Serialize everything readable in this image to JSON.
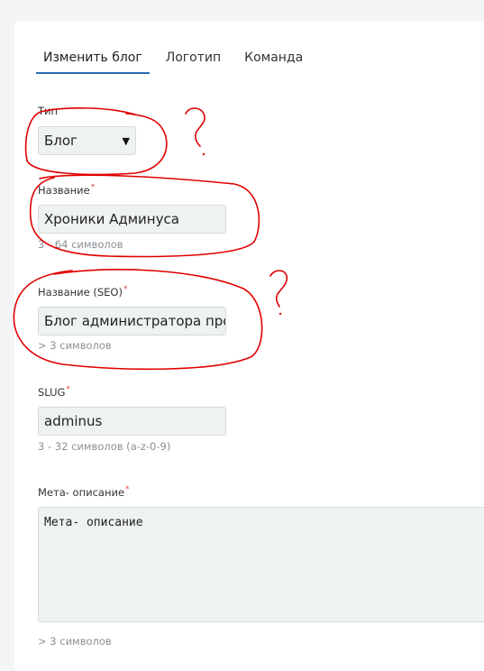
{
  "tabs": [
    {
      "label": "Изменить блог",
      "active": true
    },
    {
      "label": "Логотип",
      "active": false
    },
    {
      "label": "Команда",
      "active": false
    }
  ],
  "form": {
    "type": {
      "label": "Тип",
      "value": "Блог"
    },
    "name": {
      "label": "Название",
      "required_mark": "*",
      "value": "Хроники Админуса",
      "hint": "3 - 64 символов"
    },
    "seo_name": {
      "label": "Название (SEO)",
      "required_mark": "*",
      "value": "Блог администратора проекта",
      "hint": "> 3 символов"
    },
    "slug": {
      "label": "SLUG",
      "required_mark": "*",
      "value": "adminus",
      "hint": "3 - 32 символов (a-z-0-9)"
    },
    "meta_description": {
      "label": "Мета- описание",
      "required_mark": "*",
      "value": "Мета- описание",
      "hint": "> 3 символов"
    }
  },
  "annotations": {
    "question_mark": "?",
    "color": "#e00000"
  }
}
